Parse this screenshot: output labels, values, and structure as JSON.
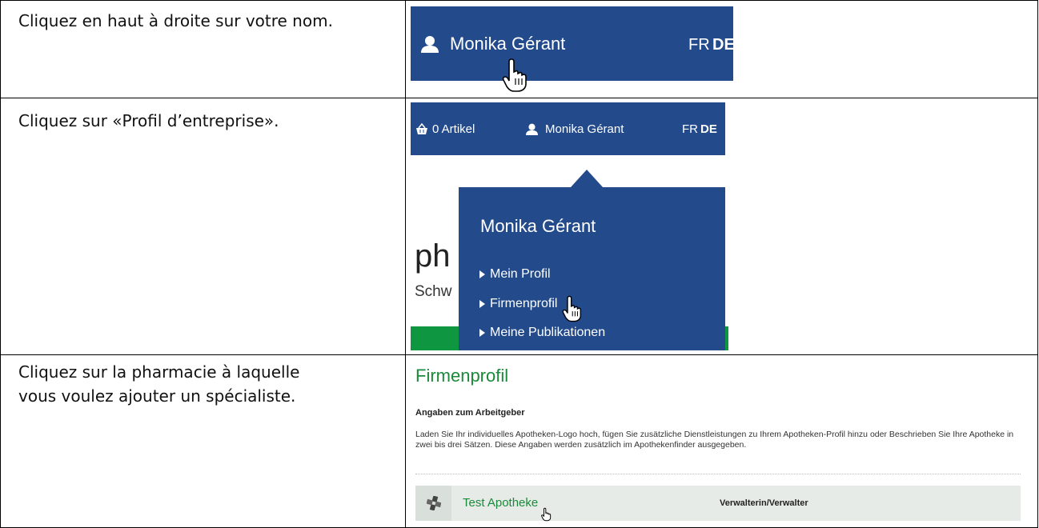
{
  "instructions": [
    {
      "lines": [
        "Cliquez en haut à droite sur votre nom."
      ]
    },
    {
      "lines": [
        "Cliquez sur «Profil d’entreprise»."
      ]
    },
    {
      "lines": [
        "Cliquez sur la pharmacie à laquelle",
        "vous voulez ajouter un spécialiste."
      ]
    }
  ],
  "panel1": {
    "user_name": "Monika Gérant",
    "lang_fr": "FR",
    "lang_de": "DE",
    "icons": [
      "user-icon",
      "hand-cursor-icon"
    ]
  },
  "panel2": {
    "cart_label": "0 Artikel",
    "user_name": "Monika Gérant",
    "lang_fr": "FR",
    "lang_de": "DE",
    "background_text_1": "ph",
    "background_text_2": "Schw",
    "dropdown": {
      "title": "Monika Gérant",
      "items": [
        "Mein Profil",
        "Firmenprofil",
        "Meine Publikationen"
      ]
    },
    "icons": [
      "basket-icon",
      "user-icon",
      "hand-cursor-icon"
    ]
  },
  "panel3": {
    "title": "Firmenprofil",
    "subtitle": "Angaben zum Arbeitgeber",
    "description": "Laden Sie Ihr individuelles Apotheken-Logo hoch, fügen Sie zusätzliche Dienstleistungen zu Ihrem Apotheken-Profil hinzu oder Beschrieben Sie Ihre Apotheke in zwei bis drei Sätzen. Diese Angaben werden zusätzlich im Apothekenfinder ausgegeben.",
    "pharmacy_name": "Test Apotheke",
    "role": "Verwalterin/Verwalter",
    "icons": [
      "pharmacy-cross-icon",
      "hand-cursor-icon"
    ]
  },
  "colors": {
    "nav_blue": "#234b8c",
    "accent_green": "#1a8a3a",
    "bar_green": "#0e9640",
    "row_bg": "#e6ebe8"
  }
}
